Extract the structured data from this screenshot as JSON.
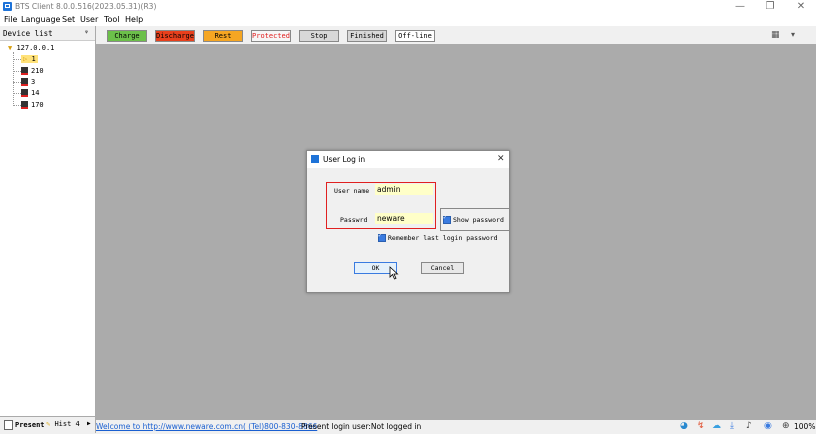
{
  "window": {
    "title": "BTS Client 8.0.0.516(2023.05.31)(R3)",
    "minimize": "—",
    "restore": "❐",
    "close": "✕"
  },
  "menu": [
    "File",
    "Language",
    "Set",
    "User",
    "Tool",
    "Help"
  ],
  "toolbar": {
    "buttons": [
      {
        "label": "Charge",
        "bg": "#6cc04a",
        "fg": "#000"
      },
      {
        "label": "Discharge",
        "bg": "#e8401c",
        "fg": "#000"
      },
      {
        "label": "Rest",
        "bg": "#f5a623",
        "fg": "#000"
      },
      {
        "label": "Protected",
        "bg": "#f6f6f6",
        "fg": "#e02020"
      },
      {
        "label": "Stop",
        "bg": "#d8d8d8",
        "fg": "#000"
      },
      {
        "label": "Finished",
        "bg": "#d8d8d8",
        "fg": "#000"
      },
      {
        "label": "Off-line",
        "bg": "#ffffff",
        "fg": "#000"
      }
    ],
    "view_icon": "▦",
    "dropdown_icon": "▾"
  },
  "sidebar": {
    "title": "Device list",
    "pin": "ᵠ",
    "root": "127.0.0.1",
    "nodes": [
      "1",
      "210",
      "3",
      "14",
      "170"
    ]
  },
  "bottom_tabs": [
    {
      "label": "Present"
    },
    {
      "label": "Hist 4"
    }
  ],
  "status": {
    "link": "Welcome to http://www.neware.com.cn( (Tel)800-830-8866",
    "login": "Present login user:Not logged in",
    "zoom": "100%"
  },
  "dialog": {
    "title": "User Log in",
    "username_label": "User name",
    "username": "admin",
    "password_label": "Passwrd",
    "password": "neware",
    "show_password": "Show password",
    "remember": "Remember last login password",
    "ok": "OK",
    "cancel": "Cancel"
  }
}
